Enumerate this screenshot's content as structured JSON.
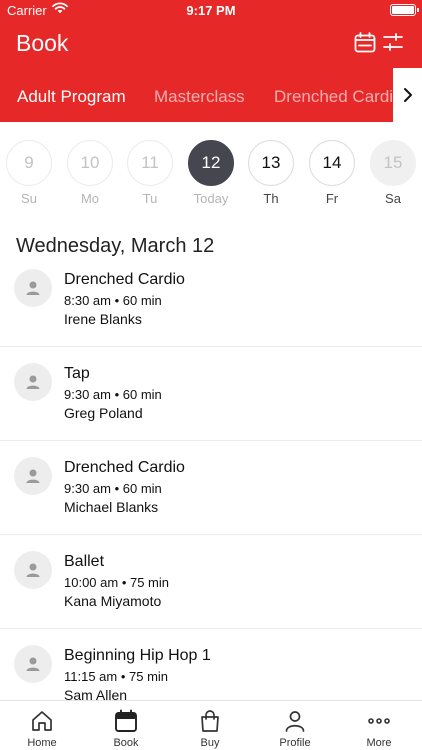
{
  "status_bar": {
    "carrier": "Carrier",
    "time": "9:17 PM"
  },
  "header": {
    "title": "Book"
  },
  "tabs": [
    {
      "label": "Adult Program",
      "active": true
    },
    {
      "label": "Masterclass",
      "active": false
    },
    {
      "label": "Drenched Cardio",
      "active": false
    }
  ],
  "days": [
    {
      "num": "9",
      "dow": "Su",
      "state": "past"
    },
    {
      "num": "10",
      "dow": "Mo",
      "state": "past"
    },
    {
      "num": "11",
      "dow": "Tu",
      "state": "past"
    },
    {
      "num": "12",
      "dow": "Today",
      "state": "selected"
    },
    {
      "num": "13",
      "dow": "Th",
      "state": "normal"
    },
    {
      "num": "14",
      "dow": "Fr",
      "state": "normal"
    },
    {
      "num": "15",
      "dow": "Sa",
      "state": "faded"
    }
  ],
  "date_heading": "Wednesday, March 12",
  "classes": [
    {
      "name": "Drenched Cardio",
      "time": "8:30 am • 60 min",
      "teacher": "Irene Blanks"
    },
    {
      "name": "Tap",
      "time": "9:30 am • 60 min",
      "teacher": "Greg Poland"
    },
    {
      "name": "Drenched Cardio",
      "time": "9:30 am • 60 min",
      "teacher": "Michael Blanks"
    },
    {
      "name": "Ballet",
      "time": "10:00 am • 75 min",
      "teacher": "Kana Miyamoto"
    },
    {
      "name": "Beginning Hip Hop 1",
      "time": "11:15 am • 75 min",
      "teacher": "Sam Allen"
    }
  ],
  "tabbar": [
    {
      "label": "Home",
      "icon": "home-icon"
    },
    {
      "label": "Book",
      "icon": "calendar-icon",
      "active": true
    },
    {
      "label": "Buy",
      "icon": "shopping-bag-icon"
    },
    {
      "label": "Profile",
      "icon": "person-icon"
    },
    {
      "label": "More",
      "icon": "more-dots-icon"
    }
  ],
  "colors": {
    "brand": "#e62828",
    "selected_day": "#45464f"
  }
}
